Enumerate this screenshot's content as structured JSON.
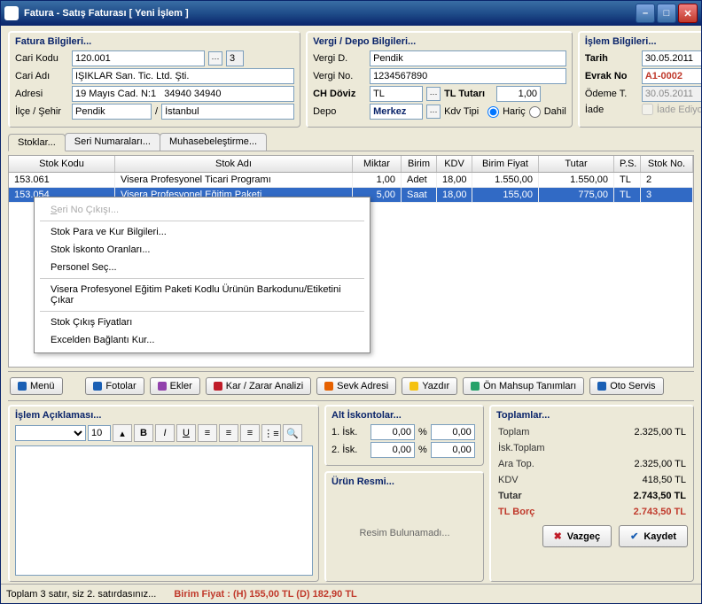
{
  "window": {
    "title": "Fatura - Satış Faturası   [ Yeni İşlem ]"
  },
  "fatura": {
    "title": "Fatura Bilgileri...",
    "cariKoduLabel": "Cari Kodu",
    "cariKodu": "120.001",
    "cariKoduExtra": "3",
    "cariAdiLabel": "Cari Adı",
    "cariAdi": "IŞIKLAR San. Tic. Ltd. Şti.",
    "adresiLabel": "Adresi",
    "adresi": "19 Mayıs Cad. N:1   34940 34940",
    "ilceLabel": "İlçe / Şehir",
    "ilce": "Pendik",
    "sehir": "İstanbul"
  },
  "vergi": {
    "title": "Vergi / Depo Bilgileri...",
    "vergiDLabel": "Vergi D.",
    "vergiD": "Pendik",
    "vergiNoLabel": "Vergi No.",
    "vergiNo": "1234567890",
    "chDovizLabel": "CH Döviz",
    "chDoviz": "TL",
    "tlTutariLabel": "TL Tutarı",
    "tlTutari": "1,00",
    "depoLabel": "Depo",
    "depo": "Merkez",
    "kdvTipiLabel": "Kdv Tipi",
    "haric": "Hariç",
    "dahil": "Dahil"
  },
  "islem": {
    "title": "İşlem Bilgileri...",
    "tarihLabel": "Tarih",
    "tarih": "30.05.2011",
    "evrakLabel": "Evrak No",
    "evrak": "A1-0002",
    "odemeLabel": "Ödeme T.",
    "odeme": "30.05.2011",
    "iadeLabel": "İade",
    "iadeText": "İade Ediyoruz"
  },
  "tabs": {
    "stoklar": "Stoklar...",
    "seri": "Seri Numaraları...",
    "muhasebe": "Muhasebeleştirme..."
  },
  "grid": {
    "cols": {
      "stokKodu": "Stok Kodu",
      "stokAdi": "Stok Adı",
      "miktar": "Miktar",
      "birim": "Birim",
      "kdv": "KDV",
      "birimFiyat": "Birim Fiyat",
      "tutar": "Tutar",
      "ps": "P.S.",
      "stokNo": "Stok No."
    },
    "rows": [
      {
        "stokKodu": "153.061",
        "stokAdi": "Visera Profesyonel Ticari Programı",
        "miktar": "1,00",
        "birim": "Adet",
        "kdv": "18,00",
        "birimFiyat": "1.550,00",
        "tutar": "1.550,00",
        "ps": "TL",
        "stokNo": "2"
      },
      {
        "stokKodu": "153.054",
        "stokAdi": "Visera Profesyonel Eğitim Paketi",
        "miktar": "5,00",
        "birim": "Saat",
        "kdv": "18,00",
        "birimFiyat": "155,00",
        "tutar": "775,00",
        "ps": "TL",
        "stokNo": "3"
      }
    ]
  },
  "context": {
    "seriCikisi": "Seri No Çıkışı...",
    "stokPara": "Stok Para ve Kur Bilgileri...",
    "iskonto": "Stok İskonto Oranları...",
    "personel": "Personel Seç...",
    "barkod": "Visera Profesyonel Eğitim Paketi Kodlu Ürünün Barkodunu/Etiketini Çıkar",
    "cikis": "Stok Çıkış Fiyatları",
    "excel": "Excelden Bağlantı Kur..."
  },
  "toolbar": {
    "menu": "Menü",
    "fotolar": "Fotolar",
    "ekler": "Ekler",
    "karzarar": "Kar / Zarar Analizi",
    "sevk": "Sevk Adresi",
    "yazdir": "Yazdır",
    "mahsup": "Ön Mahsup Tanımları",
    "oto": "Oto Servis"
  },
  "aciklama": {
    "title": "İşlem Açıklaması...",
    "fontsize": "10"
  },
  "iskonto": {
    "title": "Alt İskontolar...",
    "l1": "1. İsk.",
    "l2": "2. İsk.",
    "v1": "0,00",
    "p": "%",
    "v2": "0,00",
    "v3": "0,00",
    "v4": "0,00"
  },
  "resim": {
    "title": "Ürün Resmi...",
    "text": "Resim Bulunamadı..."
  },
  "toplam": {
    "title": "Toplamlar...",
    "toplamL": "Toplam",
    "toplamV": "2.325,00 TL",
    "iskL": "İsk.Toplam",
    "iskV": "",
    "araL": "Ara Top.",
    "araV": "2.325,00 TL",
    "kdvL": "KDV",
    "kdvV": "418,50 TL",
    "tutarL": "Tutar",
    "tutarV": "2.743,50 TL",
    "borcL": "TL Borç",
    "borcV": "2.743,50 TL"
  },
  "actions": {
    "vazgec": "Vazgeç",
    "kaydet": "Kaydet"
  },
  "status": {
    "left": "Toplam 3 satır, siz 2. satırdasınız...",
    "right": "Birim Fiyat :   (H) 155,00 TL     (D) 182,90 TL"
  }
}
